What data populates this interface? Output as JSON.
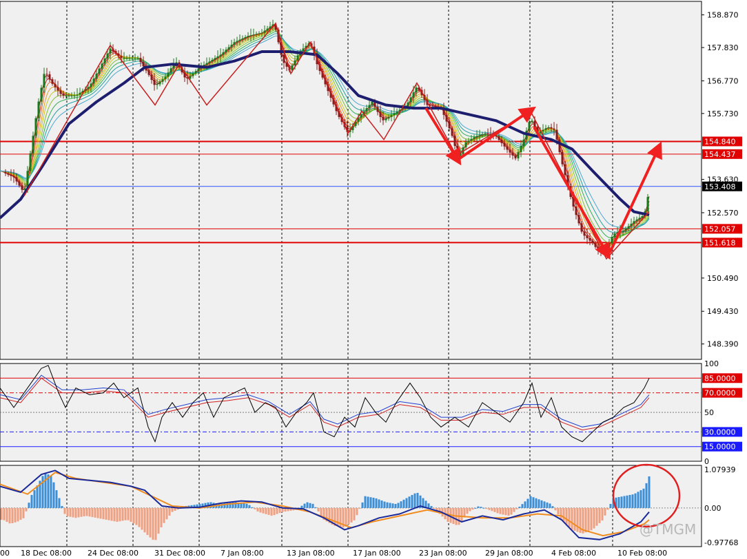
{
  "chart_data": {
    "type": "line",
    "title": "",
    "xlabel": "",
    "ylabel": "",
    "colors": {
      "background": "#f0f0f0",
      "candle_up": "#1a7a1a",
      "candle_down": "#8b1a1a",
      "ma_slow": "#1e1e6e",
      "level": "#e00000",
      "arrow": "#f02020",
      "zigzag": "#c81e1e",
      "hist_pos": "#3a8fd8",
      "hist_neg": "#f0a080",
      "macd_line": "#1a2a9a",
      "signal_line": "#f08c1e",
      "current_badge": "#000000",
      "blue_badge": "#1a1aff"
    },
    "x_labels": [
      "00",
      "18 Dec 08:00",
      "24 Dec 08:00",
      "31 Dec 08:00",
      "7 Jan 08:00",
      "13 Jan 08:00",
      "17 Jan 08:00",
      "23 Jan 08:00",
      "29 Jan 08:00",
      "4 Feb 08:00",
      "10 Feb 08:00"
    ],
    "price_panel": {
      "ylim": [
        147.9,
        159.3
      ],
      "ticks": [
        "158.870",
        "157.830",
        "156.770",
        "155.730",
        "154.840",
        "154.437",
        "153.630",
        "153.408",
        "152.570",
        "152.057",
        "151.618",
        "150.490",
        "149.430",
        "148.390"
      ],
      "price_path": [
        [
          0,
          153.9
        ],
        [
          20,
          153.7
        ],
        [
          35,
          153.2
        ],
        [
          45,
          154.6
        ],
        [
          55,
          156.0
        ],
        [
          65,
          157.1
        ],
        [
          75,
          156.7
        ],
        [
          90,
          156.3
        ],
        [
          110,
          156.3
        ],
        [
          130,
          156.6
        ],
        [
          160,
          157.8
        ],
        [
          175,
          157.5
        ],
        [
          200,
          157.5
        ],
        [
          215,
          157.0
        ],
        [
          225,
          156.6
        ],
        [
          240,
          156.9
        ],
        [
          255,
          157.4
        ],
        [
          270,
          156.8
        ],
        [
          290,
          157.2
        ],
        [
          305,
          157.4
        ],
        [
          320,
          157.6
        ],
        [
          340,
          158.0
        ],
        [
          360,
          158.2
        ],
        [
          380,
          158.3
        ],
        [
          398,
          158.6
        ],
        [
          410,
          157.4
        ],
        [
          420,
          157.1
        ],
        [
          435,
          157.7
        ],
        [
          450,
          158.0
        ],
        [
          460,
          157.3
        ],
        [
          475,
          156.5
        ],
        [
          490,
          155.7
        ],
        [
          505,
          155.1
        ],
        [
          520,
          155.6
        ],
        [
          540,
          156.1
        ],
        [
          555,
          155.5
        ],
        [
          570,
          155.7
        ],
        [
          590,
          156.0
        ],
        [
          605,
          156.6
        ],
        [
          620,
          156.0
        ],
        [
          640,
          155.9
        ],
        [
          655,
          155.1
        ],
        [
          665,
          154.3
        ],
        [
          675,
          154.8
        ],
        [
          690,
          155.0
        ],
        [
          705,
          155.1
        ],
        [
          720,
          155.0
        ],
        [
          735,
          154.6
        ],
        [
          748,
          154.3
        ],
        [
          760,
          154.9
        ],
        [
          770,
          155.6
        ],
        [
          780,
          155.1
        ],
        [
          795,
          155.3
        ],
        [
          805,
          155.2
        ],
        [
          815,
          154.2
        ],
        [
          830,
          152.9
        ],
        [
          845,
          151.9
        ],
        [
          860,
          151.6
        ],
        [
          870,
          151.3
        ],
        [
          880,
          151.4
        ],
        [
          890,
          151.9
        ],
        [
          905,
          152.0
        ],
        [
          920,
          152.3
        ],
        [
          935,
          152.5
        ],
        [
          942,
          153.3
        ]
      ],
      "ma_slow": [
        [
          0,
          152.4
        ],
        [
          30,
          153.0
        ],
        [
          60,
          154.0
        ],
        [
          100,
          155.4
        ],
        [
          140,
          156.1
        ],
        [
          180,
          156.7
        ],
        [
          210,
          157.2
        ],
        [
          250,
          157.3
        ],
        [
          300,
          157.2
        ],
        [
          340,
          157.4
        ],
        [
          380,
          157.7
        ],
        [
          420,
          157.7
        ],
        [
          460,
          157.6
        ],
        [
          490,
          157.0
        ],
        [
          520,
          156.3
        ],
        [
          560,
          156.0
        ],
        [
          600,
          155.9
        ],
        [
          640,
          155.9
        ],
        [
          680,
          155.7
        ],
        [
          720,
          155.5
        ],
        [
          760,
          155.1
        ],
        [
          800,
          154.9
        ],
        [
          830,
          154.6
        ],
        [
          860,
          153.9
        ],
        [
          900,
          153.0
        ],
        [
          920,
          152.6
        ],
        [
          942,
          152.5
        ]
      ],
      "zigzag": [
        [
          35,
          153.1
        ],
        [
          160,
          157.9
        ],
        [
          225,
          156.0
        ],
        [
          260,
          157.3
        ],
        [
          300,
          156.0
        ],
        [
          400,
          158.6
        ],
        [
          422,
          157.0
        ],
        [
          450,
          158.0
        ],
        [
          505,
          155.1
        ],
        [
          525,
          155.8
        ],
        [
          557,
          154.9
        ],
        [
          605,
          156.7
        ],
        [
          662,
          154.4
        ],
        [
          770,
          155.8
        ],
        [
          880,
          151.1
        ],
        [
          942,
          152.6
        ]
      ],
      "arrows": [
        {
          "from": [
            618,
            155.9
          ],
          "to": [
            663,
            154.3
          ]
        },
        {
          "from": [
            667,
            154.3
          ],
          "to": [
            768,
            155.8
          ]
        },
        {
          "from": [
            775,
            155.3
          ],
          "to": [
            880,
            151.3
          ]
        },
        {
          "from": [
            885,
            151.3
          ],
          "to": [
            955,
            154.6
          ]
        }
      ],
      "levels": [
        {
          "value": 154.84,
          "label": "154.840",
          "width": 2
        },
        {
          "value": 154.437,
          "label": "154.437",
          "width": 1
        },
        {
          "value": 152.057,
          "label": "152.057",
          "width": 1
        },
        {
          "value": 151.618,
          "label": "151.618",
          "width": 2
        }
      ],
      "current": {
        "value": 153.408,
        "label": "153.408"
      }
    },
    "stoch_panel": {
      "ylim": [
        0,
        100
      ],
      "ticks": [
        "100",
        "85.0000",
        "70.0000",
        "50",
        "30.0000",
        "15.0000",
        "0"
      ],
      "levels": [
        85,
        70,
        50,
        30,
        15
      ],
      "k_line": [
        [
          0,
          75
        ],
        [
          20,
          55
        ],
        [
          30,
          65
        ],
        [
          45,
          80
        ],
        [
          60,
          95
        ],
        [
          70,
          98
        ],
        [
          85,
          70
        ],
        [
          95,
          55
        ],
        [
          110,
          75
        ],
        [
          130,
          68
        ],
        [
          150,
          70
        ],
        [
          165,
          80
        ],
        [
          180,
          65
        ],
        [
          200,
          75
        ],
        [
          215,
          35
        ],
        [
          225,
          20
        ],
        [
          235,
          45
        ],
        [
          250,
          60
        ],
        [
          265,
          45
        ],
        [
          280,
          60
        ],
        [
          295,
          70
        ],
        [
          310,
          45
        ],
        [
          325,
          65
        ],
        [
          340,
          70
        ],
        [
          355,
          75
        ],
        [
          370,
          50
        ],
        [
          385,
          60
        ],
        [
          400,
          55
        ],
        [
          415,
          35
        ],
        [
          430,
          50
        ],
        [
          445,
          60
        ],
        [
          455,
          70
        ],
        [
          470,
          30
        ],
        [
          485,
          25
        ],
        [
          500,
          45
        ],
        [
          515,
          35
        ],
        [
          530,
          65
        ],
        [
          545,
          50
        ],
        [
          560,
          40
        ],
        [
          575,
          60
        ],
        [
          595,
          80
        ],
        [
          610,
          65
        ],
        [
          625,
          45
        ],
        [
          640,
          35
        ],
        [
          660,
          45
        ],
        [
          680,
          35
        ],
        [
          700,
          60
        ],
        [
          720,
          50
        ],
        [
          740,
          40
        ],
        [
          760,
          60
        ],
        [
          772,
          80
        ],
        [
          785,
          45
        ],
        [
          800,
          65
        ],
        [
          815,
          35
        ],
        [
          830,
          25
        ],
        [
          845,
          20
        ],
        [
          860,
          30
        ],
        [
          875,
          40
        ],
        [
          890,
          45
        ],
        [
          905,
          55
        ],
        [
          920,
          60
        ],
        [
          935,
          75
        ],
        [
          942,
          85
        ]
      ],
      "d_line": [
        [
          0,
          65
        ],
        [
          30,
          60
        ],
        [
          60,
          85
        ],
        [
          90,
          70
        ],
        [
          120,
          70
        ],
        [
          150,
          72
        ],
        [
          180,
          70
        ],
        [
          215,
          45
        ],
        [
          240,
          50
        ],
        [
          270,
          55
        ],
        [
          300,
          60
        ],
        [
          330,
          62
        ],
        [
          360,
          65
        ],
        [
          390,
          58
        ],
        [
          420,
          45
        ],
        [
          450,
          58
        ],
        [
          470,
          40
        ],
        [
          490,
          35
        ],
        [
          520,
          45
        ],
        [
          550,
          48
        ],
        [
          580,
          58
        ],
        [
          610,
          55
        ],
        [
          640,
          42
        ],
        [
          670,
          42
        ],
        [
          700,
          50
        ],
        [
          730,
          48
        ],
        [
          760,
          55
        ],
        [
          785,
          55
        ],
        [
          815,
          40
        ],
        [
          845,
          32
        ],
        [
          870,
          35
        ],
        [
          900,
          45
        ],
        [
          930,
          55
        ],
        [
          942,
          65
        ]
      ]
    },
    "macd_panel": {
      "ylim": [
        -0.97768,
        1.07939
      ],
      "ticks": [
        "1.07939",
        "0.00",
        "-0.97768"
      ],
      "histogram": [
        [
          5,
          -0.3
        ],
        [
          15,
          -0.4
        ],
        [
          25,
          -0.35
        ],
        [
          35,
          -0.25
        ],
        [
          45,
          0.3
        ],
        [
          55,
          0.6
        ],
        [
          65,
          0.9
        ],
        [
          75,
          0.8
        ],
        [
          85,
          0.3
        ],
        [
          95,
          -0.2
        ],
        [
          110,
          -0.25
        ],
        [
          125,
          -0.2
        ],
        [
          140,
          -0.25
        ],
        [
          155,
          -0.3
        ],
        [
          170,
          -0.35
        ],
        [
          185,
          -0.3
        ],
        [
          200,
          -0.45
        ],
        [
          215,
          -0.7
        ],
        [
          225,
          -0.85
        ],
        [
          235,
          -0.45
        ],
        [
          250,
          -0.1
        ],
        [
          270,
          0.05
        ],
        [
          290,
          0.1
        ],
        [
          305,
          0.15
        ],
        [
          320,
          0.1
        ],
        [
          340,
          0.15
        ],
        [
          360,
          0.1
        ],
        [
          375,
          -0.1
        ],
        [
          395,
          -0.2
        ],
        [
          410,
          -0.1
        ],
        [
          430,
          -0.05
        ],
        [
          445,
          0.15
        ],
        [
          455,
          0.1
        ],
        [
          470,
          -0.3
        ],
        [
          485,
          -0.45
        ],
        [
          500,
          -0.5
        ],
        [
          515,
          -0.3
        ],
        [
          530,
          0.3
        ],
        [
          545,
          0.25
        ],
        [
          560,
          0.15
        ],
        [
          575,
          0.1
        ],
        [
          590,
          0.25
        ],
        [
          605,
          0.4
        ],
        [
          620,
          0.15
        ],
        [
          635,
          -0.1
        ],
        [
          650,
          -0.35
        ],
        [
          665,
          -0.45
        ],
        [
          680,
          -0.1
        ],
        [
          695,
          0.05
        ],
        [
          710,
          -0.05
        ],
        [
          725,
          -0.15
        ],
        [
          740,
          -0.2
        ],
        [
          755,
          0.05
        ],
        [
          770,
          0.3
        ],
        [
          785,
          0.2
        ],
        [
          800,
          0.1
        ],
        [
          815,
          -0.3
        ],
        [
          830,
          -0.55
        ],
        [
          845,
          -0.65
        ],
        [
          860,
          -0.55
        ],
        [
          875,
          -0.3
        ],
        [
          890,
          0.25
        ],
        [
          905,
          0.3
        ],
        [
          920,
          0.35
        ],
        [
          935,
          0.5
        ],
        [
          942,
          0.8
        ]
      ],
      "macd_line": [
        [
          0,
          0.55
        ],
        [
          30,
          0.4
        ],
        [
          60,
          0.85
        ],
        [
          80,
          0.95
        ],
        [
          100,
          0.75
        ],
        [
          130,
          0.7
        ],
        [
          160,
          0.65
        ],
        [
          190,
          0.55
        ],
        [
          210,
          0.45
        ],
        [
          235,
          0.05
        ],
        [
          260,
          0.0
        ],
        [
          290,
          0.02
        ],
        [
          320,
          0.12
        ],
        [
          350,
          0.18
        ],
        [
          380,
          0.15
        ],
        [
          410,
          0.0
        ],
        [
          440,
          -0.02
        ],
        [
          470,
          -0.25
        ],
        [
          500,
          -0.55
        ],
        [
          520,
          -0.45
        ],
        [
          550,
          -0.25
        ],
        [
          580,
          -0.15
        ],
        [
          610,
          0.05
        ],
        [
          640,
          -0.1
        ],
        [
          670,
          -0.35
        ],
        [
          700,
          -0.2
        ],
        [
          730,
          -0.3
        ],
        [
          760,
          -0.15
        ],
        [
          790,
          -0.05
        ],
        [
          815,
          -0.3
        ],
        [
          840,
          -0.75
        ],
        [
          870,
          -0.8
        ],
        [
          900,
          -0.65
        ],
        [
          930,
          -0.35
        ],
        [
          942,
          -0.1
        ]
      ],
      "signal_line": [
        [
          0,
          0.6
        ],
        [
          40,
          0.35
        ],
        [
          80,
          0.9
        ],
        [
          110,
          0.75
        ],
        [
          150,
          0.65
        ],
        [
          190,
          0.55
        ],
        [
          220,
          0.3
        ],
        [
          250,
          0.05
        ],
        [
          290,
          0.0
        ],
        [
          330,
          0.1
        ],
        [
          370,
          0.15
        ],
        [
          410,
          0.05
        ],
        [
          450,
          -0.1
        ],
        [
          480,
          -0.3
        ],
        [
          510,
          -0.5
        ],
        [
          540,
          -0.35
        ],
        [
          580,
          -0.2
        ],
        [
          620,
          -0.05
        ],
        [
          660,
          -0.2
        ],
        [
          700,
          -0.25
        ],
        [
          740,
          -0.25
        ],
        [
          780,
          -0.15
        ],
        [
          815,
          -0.2
        ],
        [
          845,
          -0.55
        ],
        [
          875,
          -0.7
        ],
        [
          905,
          -0.6
        ],
        [
          935,
          -0.4
        ],
        [
          942,
          -0.3
        ]
      ]
    },
    "watermark": "@TMGM"
  }
}
